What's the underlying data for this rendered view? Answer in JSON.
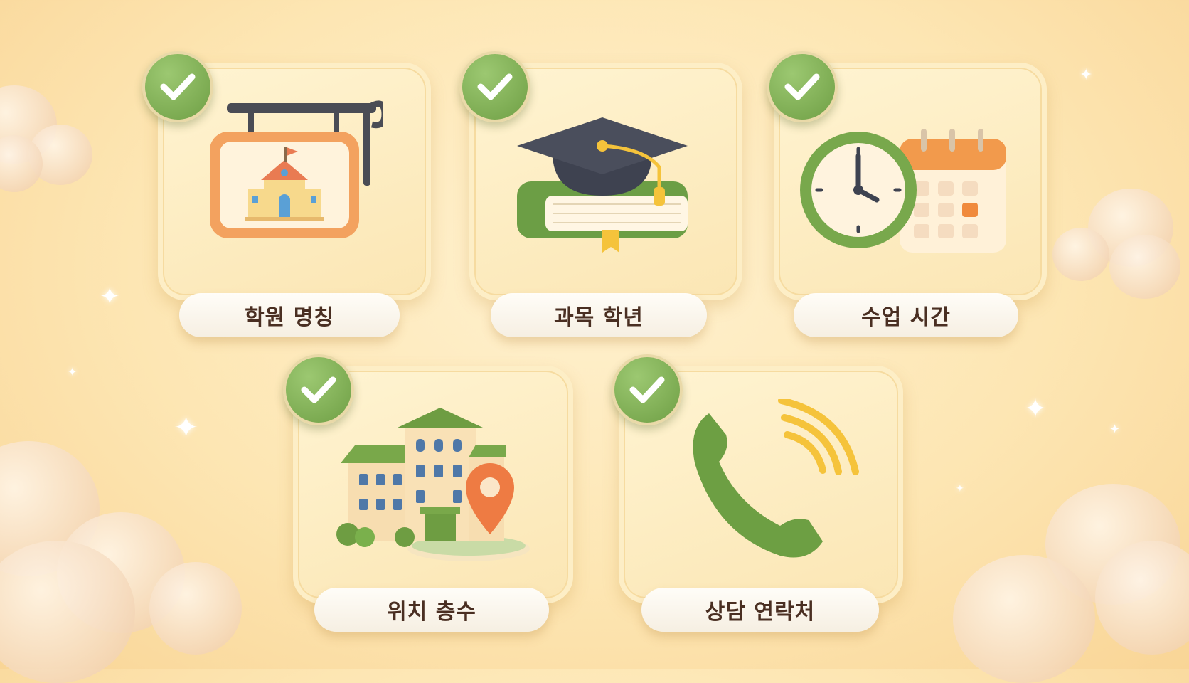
{
  "cards": [
    {
      "label": "학원 명칭",
      "icon": "academy-sign-icon"
    },
    {
      "label": "과목 학년",
      "icon": "graduation-cap-book-icon"
    },
    {
      "label": "수업 시간",
      "icon": "clock-calendar-icon"
    },
    {
      "label": "위치 층수",
      "icon": "building-location-icon"
    },
    {
      "label": "상담 연락처",
      "icon": "phone-icon"
    }
  ],
  "colors": {
    "check_green": "#7aab4e",
    "accent_orange": "#f08a4a",
    "background": "#fde6b3"
  }
}
